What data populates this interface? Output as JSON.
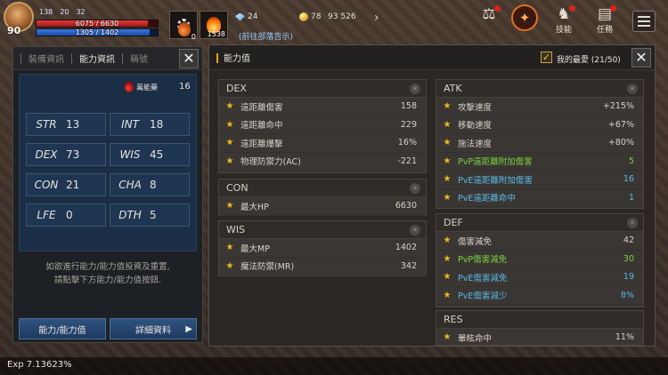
{
  "hud": {
    "level": "90",
    "stat_a": "138",
    "stat_b": "20",
    "stat_c": "32",
    "hp_text": "6075 / 6630",
    "hp_fill": 0.916,
    "mp_text": "1305 / 1402",
    "mp_fill": 0.931,
    "slot1_count": "0",
    "slot2_count": "1538",
    "gem_value": "24",
    "coin_value": "78",
    "ticket_value": "93",
    "extra_value": "526",
    "quest_text": "(前往部落告示)",
    "icon_labels": {
      "bag": "",
      "skills": "技能",
      "quests": "任務"
    }
  },
  "left_panel": {
    "tabs": [
      "裝備資訊",
      "能力資訊",
      "稱號"
    ],
    "active_tab": 1,
    "elixir_label": "萬能藥",
    "elixir_count": "16",
    "stats": [
      {
        "name": "STR",
        "value": "13"
      },
      {
        "name": "INT",
        "value": "18"
      },
      {
        "name": "DEX",
        "value": "73"
      },
      {
        "name": "WIS",
        "value": "45"
      },
      {
        "name": "CON",
        "value": "21"
      },
      {
        "name": "CHA",
        "value": "8"
      },
      {
        "name": "LFE",
        "value": "0"
      },
      {
        "name": "DTH",
        "value": "5"
      }
    ],
    "hint_line1": "如欲進行能力/能力值投資及重置,",
    "hint_line2": "請點擊下方能力/能力值按鈕.",
    "btn_ability": "能力/能力值",
    "btn_detail": "詳細資料"
  },
  "right_panel": {
    "title": "能力值",
    "favorites": "我的最愛 (21/50)",
    "sections": {
      "dex": {
        "title": "DEX",
        "rows": [
          {
            "label": "遠距離傷害",
            "value": "158"
          },
          {
            "label": "遠距離命中",
            "value": "229"
          },
          {
            "label": "遠距離爆擊",
            "value": "16%"
          },
          {
            "label": "物理防禦力(AC)",
            "value": "-221"
          }
        ]
      },
      "con": {
        "title": "CON",
        "rows": [
          {
            "label": "最大HP",
            "value": "6630"
          }
        ]
      },
      "wis": {
        "title": "WIS",
        "rows": [
          {
            "label": "最大MP",
            "value": "1402"
          },
          {
            "label": "魔法防禦(MR)",
            "value": "342"
          }
        ]
      },
      "atk": {
        "title": "ATK",
        "rows": [
          {
            "label": "攻擊速度",
            "value": "+215%"
          },
          {
            "label": "移動速度",
            "value": "+67%"
          },
          {
            "label": "施法速度",
            "value": "+80%"
          },
          {
            "label": "PvP遠距離附加傷害",
            "value": "5"
          },
          {
            "label": "PvE遠距離附加傷害",
            "value": "16"
          },
          {
            "label": "PvE遠距離命中",
            "value": "1"
          }
        ]
      },
      "def": {
        "title": "DEF",
        "rows": [
          {
            "label": "傷害減免",
            "value": "42"
          },
          {
            "label": "PvP傷害減免",
            "value": "30"
          },
          {
            "label": "PvE傷害減免",
            "value": "19"
          },
          {
            "label": "PvE傷害減少",
            "value": "8%"
          }
        ]
      },
      "res": {
        "title": "RES",
        "rows": [
          {
            "label": "暈眩命中",
            "value": "11%"
          }
        ]
      }
    }
  },
  "exp": {
    "text": "Exp 7.13623%"
  },
  "colors": {
    "accent": "#e8a020",
    "green": "#7ad040",
    "blue": "#5ab8e8",
    "panel_blue": "#1a2e45"
  }
}
